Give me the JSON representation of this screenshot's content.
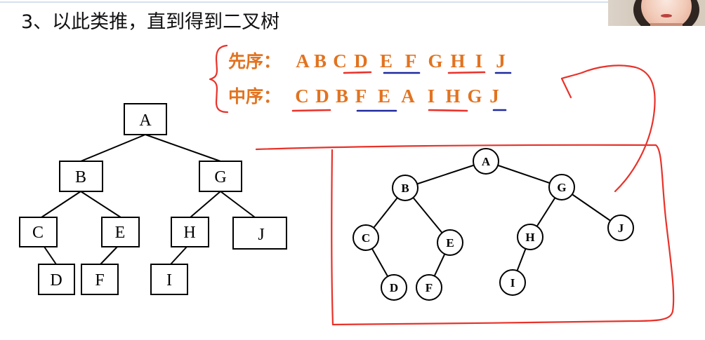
{
  "title": "3、以此类推，直到得到二叉树",
  "colors": {
    "sequence_text": "#e27320",
    "annotation_red": "#e8322a",
    "annotation_blue": "#1e2a9e",
    "diagram_stroke": "#000000"
  },
  "preorder": {
    "label": "先序：",
    "sequence": [
      "A",
      "B",
      "C",
      "D",
      "E",
      "F",
      "G",
      "H",
      "I",
      "J"
    ]
  },
  "inorder": {
    "label": "中序：",
    "sequence": [
      "C",
      "D",
      "B",
      "F",
      "E",
      "A",
      "I",
      "H",
      "G",
      "J"
    ]
  },
  "box_tree": {
    "label": "A",
    "left": {
      "label": "B",
      "left": {
        "label": "C",
        "right": {
          "label": "D"
        }
      },
      "right": {
        "label": "E",
        "left": {
          "label": "F"
        }
      }
    },
    "right": {
      "label": "G",
      "left": {
        "label": "H",
        "left": {
          "label": "I"
        }
      },
      "right": {
        "label": "J"
      }
    }
  },
  "circle_tree": {
    "label": "A",
    "left": {
      "label": "B",
      "left": {
        "label": "C",
        "right": {
          "label": "D"
        }
      },
      "right": {
        "label": "E",
        "left": {
          "label": "F"
        }
      }
    },
    "right": {
      "label": "G",
      "left": {
        "label": "H",
        "left": {
          "label": "I"
        }
      },
      "right": {
        "label": "J"
      }
    }
  }
}
